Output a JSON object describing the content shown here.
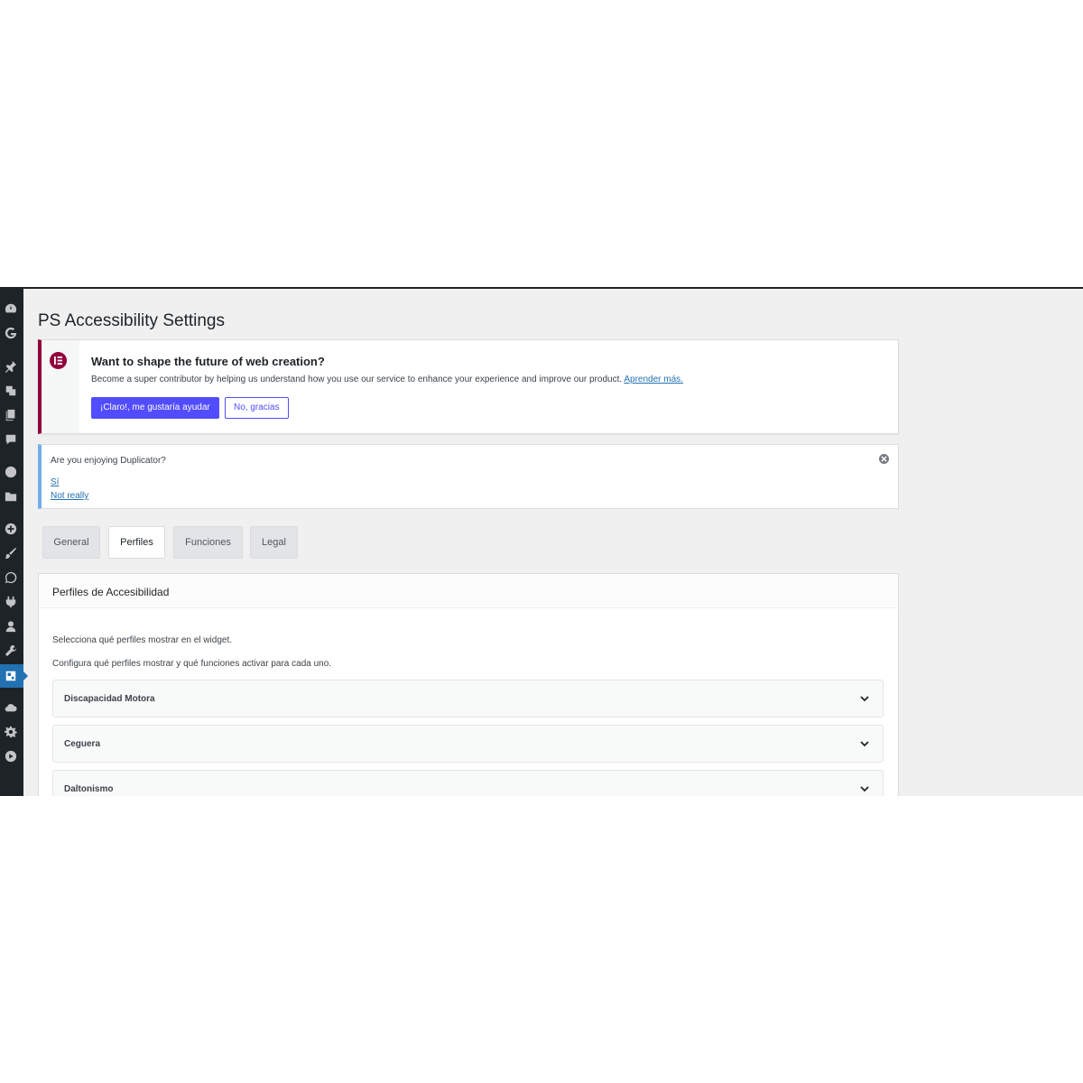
{
  "page": {
    "title": "PS Accessibility Settings"
  },
  "sidebar": {
    "icons": [
      "dashboard-icon",
      "g-icon",
      "pin-icon",
      "media-icon",
      "pages-icon",
      "comments-icon",
      "elementor-icon",
      "folder-icon",
      "plus-circle-icon",
      "brush-icon",
      "whatsapp-icon",
      "plugins-icon",
      "users-icon",
      "tools-icon",
      "accessibility-icon",
      "cloud-icon",
      "settings-icon",
      "play-icon"
    ],
    "active_icon": "accessibility-icon"
  },
  "elementor_notice": {
    "title": "Want to shape the future of web creation?",
    "text": "Become a super contributor by helping us understand how you use our service to enhance your experience and improve our product.",
    "link": "Aprender más.",
    "primary_button": "¡Claro!, me gustaría ayudar",
    "secondary_button": "No, gracias",
    "accent_color": "#92003b",
    "button_color": "#524cff"
  },
  "duplicator_notice": {
    "question": "Are you enjoying Duplicator?",
    "yes": "Sí",
    "no": "Not really",
    "accent_color": "#72aee6"
  },
  "tabs": [
    {
      "label": "General",
      "active": false
    },
    {
      "label": "Perfiles",
      "active": true
    },
    {
      "label": "Funciones",
      "active": false
    },
    {
      "label": "Legal",
      "active": false
    }
  ],
  "panel": {
    "title": "Perfiles de Accesibilidad",
    "desc1": "Selecciona qué perfiles mostrar en el widget.",
    "desc2": "Configura qué perfiles mostrar y qué funciones activar para cada uno.",
    "profiles": [
      "Discapacidad Motora",
      "Ceguera",
      "Daltonismo"
    ]
  }
}
